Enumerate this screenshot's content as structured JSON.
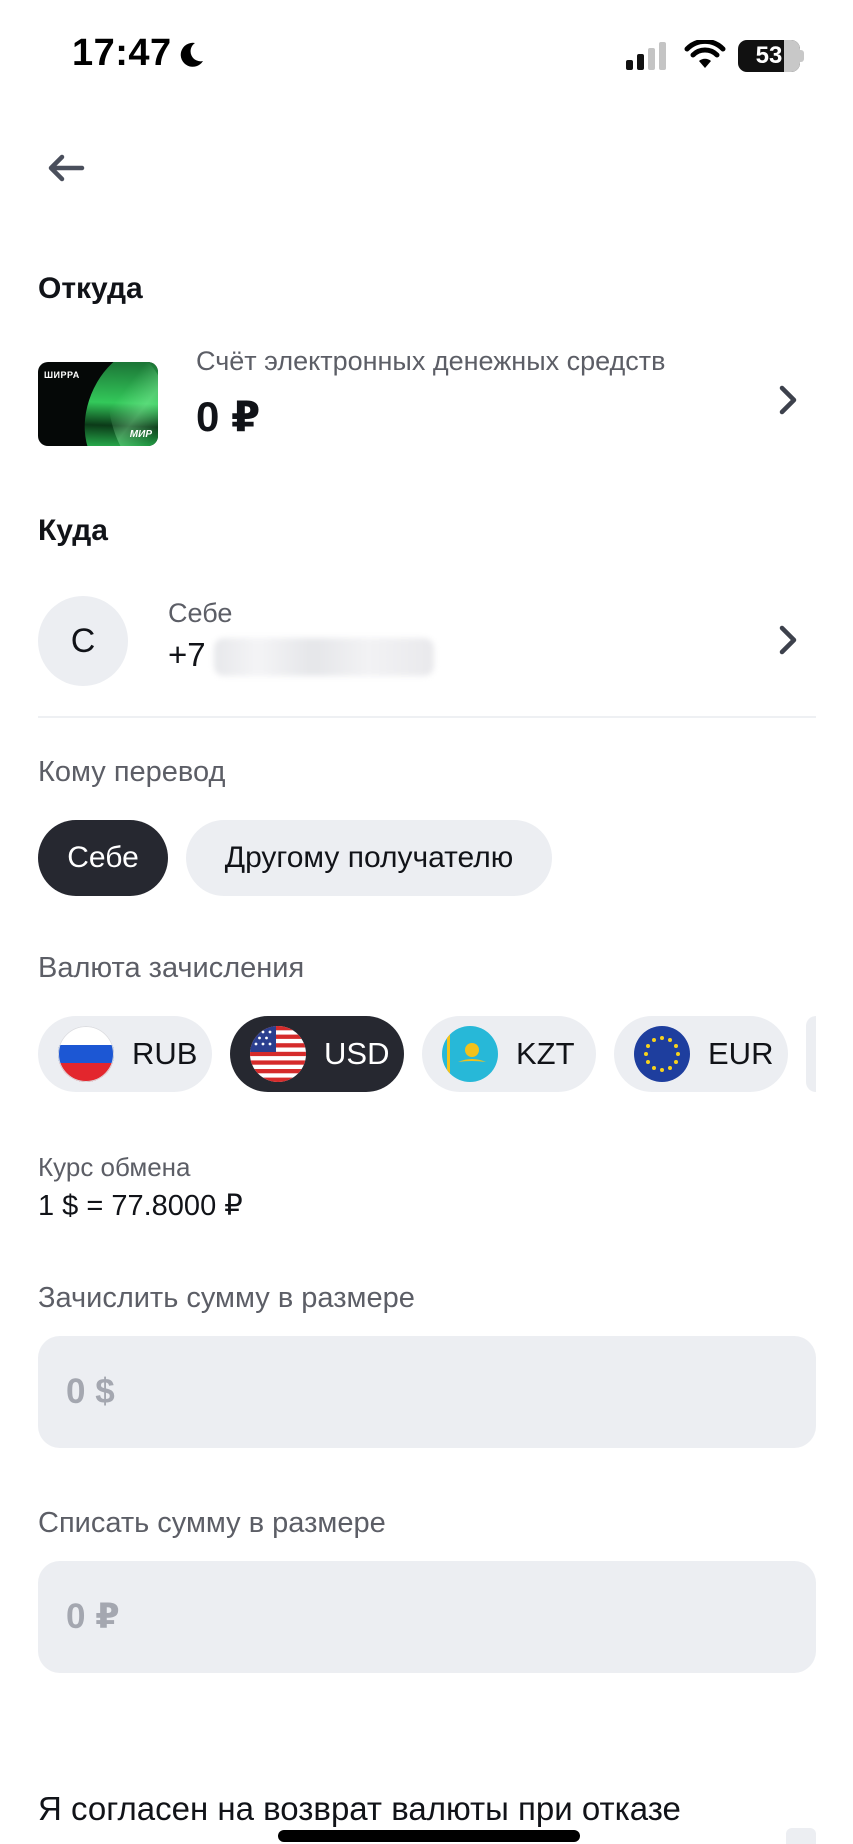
{
  "status_bar": {
    "time": "17:47",
    "battery_level": "53",
    "icons": [
      "moon-icon",
      "signal-icon",
      "wifi-icon",
      "battery-icon"
    ]
  },
  "header": {
    "back_icon": "arrow-left-icon"
  },
  "from": {
    "title": "Откуда",
    "card_brand": "ШИРРА",
    "card_network": "МИР",
    "account_label": "Счёт электронных денежных средств",
    "balance": "0 ₽"
  },
  "to": {
    "title": "Куда",
    "avatar_initial": "С",
    "recipient_label": "Себе",
    "phone_prefix": "+7"
  },
  "recipient_type": {
    "label": "Кому перевод",
    "options": [
      {
        "label": "Себе",
        "selected": true
      },
      {
        "label": "Другому получателю",
        "selected": false
      }
    ]
  },
  "currency": {
    "label": "Валюта зачисления",
    "options": [
      {
        "code": "RUB",
        "flag": "russia-flag",
        "selected": false
      },
      {
        "code": "USD",
        "flag": "usa-flag",
        "selected": true
      },
      {
        "code": "KZT",
        "flag": "kazakhstan-flag",
        "selected": false
      },
      {
        "code": "EUR",
        "flag": "eu-flag",
        "selected": false
      }
    ]
  },
  "exchange": {
    "label": "Курс обмена",
    "value": "1 $ = 77.8000 ₽"
  },
  "credit_amount": {
    "label": "Зачислить сумму в размере",
    "placeholder": "0 $"
  },
  "debit_amount": {
    "label": "Списать сумму в размере",
    "placeholder": "0 ₽"
  },
  "agreement": {
    "text": "Я согласен на возврат валюты при отказе"
  },
  "colors": {
    "chip_bg": "#eceef2",
    "chip_active_bg": "#262830",
    "muted_text": "#5c5e66",
    "placeholder": "#a4a7b0"
  }
}
